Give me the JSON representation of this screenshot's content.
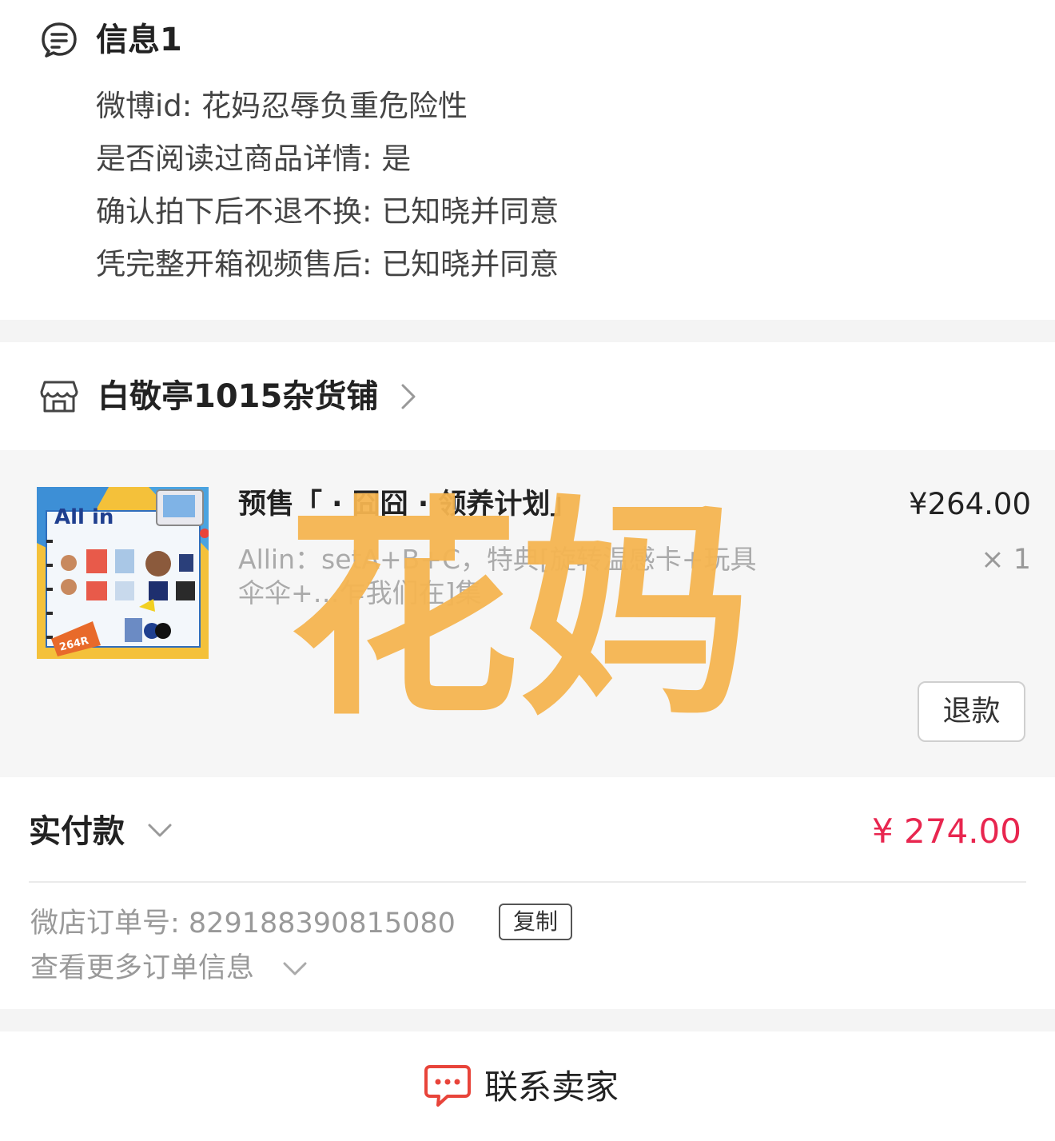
{
  "info": {
    "title": "信息1",
    "lines": [
      "微博id: 花妈忍辱负重危险性",
      "是否阅读过商品详情: 是",
      "确认拍下后不退不换: 已知晓并同意",
      "凭完整开箱视频售后: 已知晓并同意"
    ]
  },
  "shop": {
    "name": "白敬亭1015杂货铺"
  },
  "product": {
    "title": "预售「 · 囧囧 · 领养计划」",
    "description": "Allin：setA+B+C，特典[旋转温感卡+玩具伞伞+…乍我们在]集",
    "price": "¥264.00",
    "quantity": "× 1",
    "refund_label": "退款",
    "thumb_text": "All in",
    "thumb_price": "264R"
  },
  "watermark": "花妈",
  "payment": {
    "label": "实付款",
    "amount": "¥ 274.00",
    "order_number": "微店订单号:  829188390815080",
    "copy_label": "复制",
    "more_info": "查看更多订单信息"
  },
  "contact": {
    "label": "联系卖家"
  },
  "colors": {
    "accent_red": "#e8264f",
    "watermark": "#f4b450",
    "background": "#f4f4f4"
  }
}
